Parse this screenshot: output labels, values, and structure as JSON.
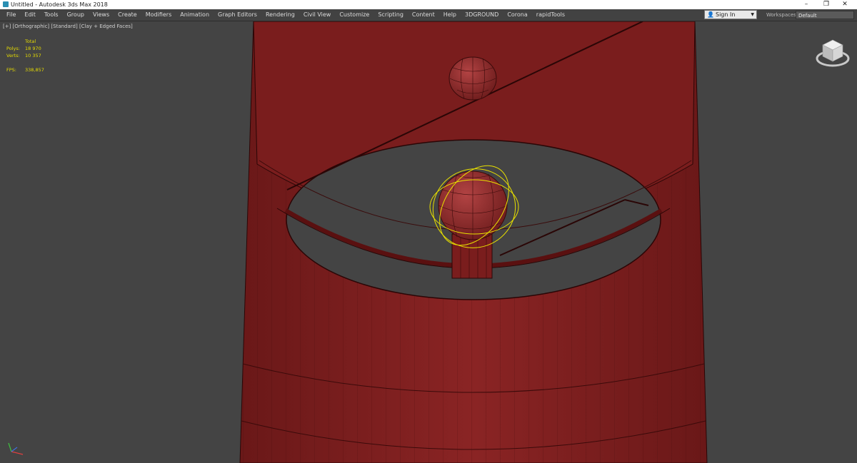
{
  "window": {
    "title": "Untitled - Autodesk 3ds Max 2018",
    "minimize_glyph": "–",
    "restore_glyph": "❐",
    "close_glyph": "✕"
  },
  "menu": {
    "items": [
      "File",
      "Edit",
      "Tools",
      "Group",
      "Views",
      "Create",
      "Modifiers",
      "Animation",
      "Graph Editors",
      "Rendering",
      "Civil View",
      "Customize",
      "Scripting",
      "Content",
      "Help",
      "3DGROUND",
      "Corona",
      "rapidTools"
    ]
  },
  "account": {
    "sign_in_label": "Sign In",
    "workspaces_label": "Workspaces:",
    "workspace_value": "Default"
  },
  "viewport": {
    "label_plus": "[+]",
    "label_view": "[Orthographic]",
    "label_shading_std": "[Standard]",
    "label_shading": "[Clay + Edged Faces]",
    "stats": {
      "header": "Total",
      "polys_label": "Polys:",
      "polys_value": "18 970",
      "verts_label": "Verts:",
      "verts_value": "10 357",
      "fps_label": "FPS:",
      "fps_value": "338,857"
    }
  },
  "colors": {
    "viewport_bg": "#444444",
    "model_fill": "#7d1f1f",
    "wire": "#3a0a0a",
    "stats_text": "#e6dc00",
    "selection_gizmo": "#e8e000"
  },
  "icons": {
    "app": "3dsmax-app-icon",
    "signin": "user-icon",
    "viewcube": "viewcube-icon",
    "axis": "axis-tripod-icon"
  }
}
